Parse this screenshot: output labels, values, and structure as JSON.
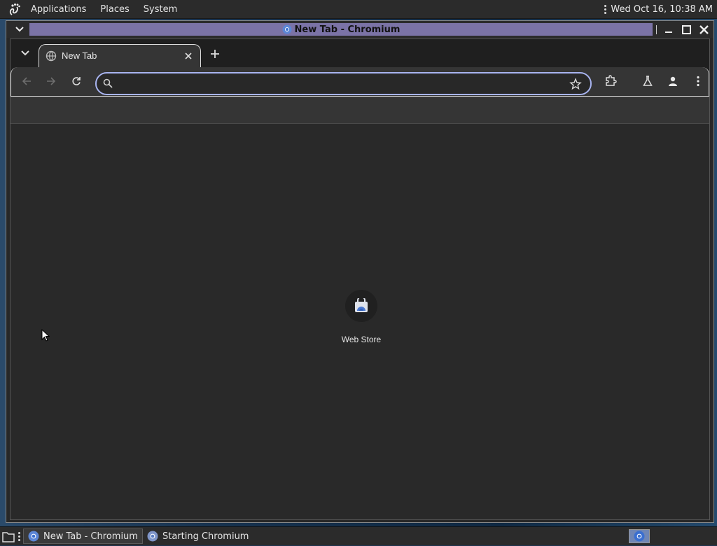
{
  "top_panel": {
    "menus": [
      "Applications",
      "Places",
      "System"
    ],
    "clock": "Wed Oct 16, 10:38 AM"
  },
  "window": {
    "title": "New Tab - Chromium"
  },
  "browser": {
    "tab_title": "New Tab",
    "omnibox": {
      "value": "",
      "placeholder": ""
    },
    "shortcut_label": "Web Store"
  },
  "taskbar": {
    "tasks": [
      "New Tab - Chromium",
      "Starting Chromium"
    ]
  },
  "colors": {
    "title_highlight": "#7b73a6",
    "omnibox_border": "#a8b4f0",
    "page_bg": "#292929"
  }
}
